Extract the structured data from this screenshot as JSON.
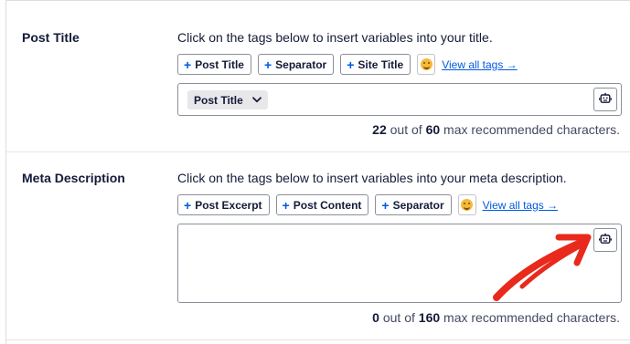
{
  "post_title": {
    "label": "Post Title",
    "instructions": "Click on the tags below to insert variables into your title.",
    "tags": [
      {
        "plus": "+",
        "label": "Post Title"
      },
      {
        "plus": "+",
        "label": "Separator"
      },
      {
        "plus": "+",
        "label": "Site Title"
      }
    ],
    "view_all": "View all tags →",
    "editor_chip": "Post Title",
    "counter": {
      "count": "22",
      "middle": " out of ",
      "max": "60",
      "suffix": " max recommended characters."
    }
  },
  "meta_description": {
    "label": "Meta Description",
    "instructions": "Click on the tags below to insert variables into your meta description.",
    "tags": [
      {
        "plus": "+",
        "label": "Post Excerpt"
      },
      {
        "plus": "+",
        "label": "Post Content"
      },
      {
        "plus": "+",
        "label": "Separator"
      }
    ],
    "view_all": "View all tags →",
    "counter": {
      "count": "0",
      "middle": " out of ",
      "max": "160",
      "suffix": " max recommended characters."
    }
  },
  "icons": {
    "emoji": "emoji-smile-icon",
    "ai": "robot-icon",
    "chevron": "chevron-down-icon",
    "annotation": "red-arrow-annotation"
  },
  "colors": {
    "accent": "#005ae0",
    "text": "#141b38",
    "annotation": "#e8291c"
  }
}
